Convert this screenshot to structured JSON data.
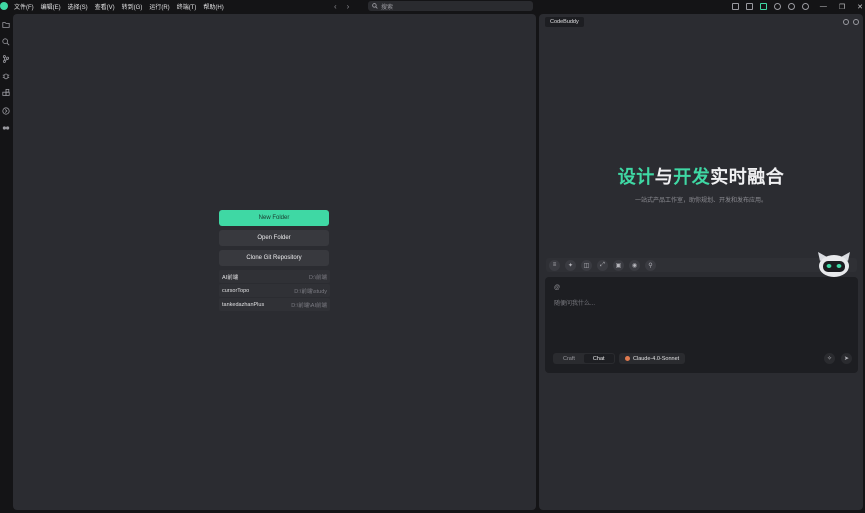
{
  "menus": [
    "文件(F)",
    "编辑(E)",
    "选择(S)",
    "查看(V)",
    "转到(G)",
    "运行(R)",
    "终端(T)",
    "帮助(H)"
  ],
  "nav": {
    "back": "‹",
    "forward": "›"
  },
  "search": {
    "placeholder": "搜索"
  },
  "window": {
    "minimize": "—",
    "restore": "❐",
    "close": "✕"
  },
  "welcome": {
    "new_folder": "New Folder",
    "open_folder": "Open Folder",
    "clone_repo": "Clone Git Repository",
    "recent": [
      {
        "name": "AI前端",
        "path": "D:\\前端"
      },
      {
        "name": "cursorTopo",
        "path": "D:\\前端\\study"
      },
      {
        "name": "tankedazhanPlus",
        "path": "D:\\前端\\AI前端"
      }
    ]
  },
  "chat": {
    "tab": "CodeBuddy",
    "hero_g1": "设计",
    "hero_w1": "与",
    "hero_g2": "开发",
    "hero_w2": "实时融合",
    "subtitle": "一站式产品工作室，助你规划、开发和发布应用。",
    "at": "@",
    "placeholder": "随便问我什么...",
    "mode_craft": "Craft",
    "mode_chat": "Chat",
    "model": "Claude-4.0-Sonnet"
  },
  "colors": {
    "accent": "#3fd8a4",
    "panel": "#2b2c31",
    "background": "#141416"
  }
}
